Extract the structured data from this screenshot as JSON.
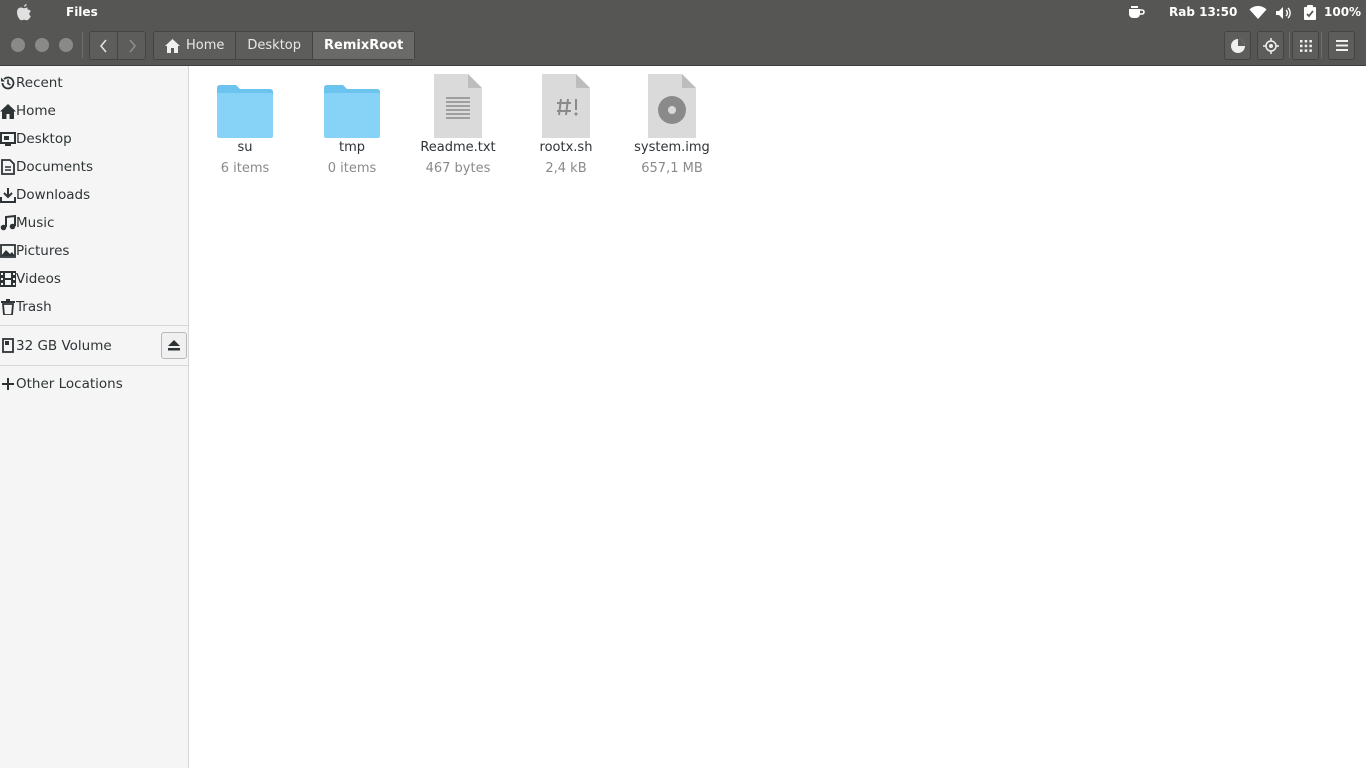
{
  "topbar": {
    "app_name": "Files",
    "clock": "Rab 13:50",
    "battery": "100%",
    "icons": [
      "apple-logo",
      "coffee-icon",
      "wifi-icon",
      "volume-icon",
      "clipboard-check-icon"
    ]
  },
  "headerbar": {
    "breadcrumbs": [
      "Home",
      "Desktop",
      "RemixRoot"
    ],
    "buttons": [
      "pie-chart-icon",
      "location-target-icon",
      "grid-view-icon",
      "menu-icon"
    ]
  },
  "sidebar": {
    "places": [
      {
        "label": "Recent",
        "icon": "recent-icon"
      },
      {
        "label": "Home",
        "icon": "home-icon"
      },
      {
        "label": "Desktop",
        "icon": "desktop-icon"
      },
      {
        "label": "Documents",
        "icon": "documents-icon"
      },
      {
        "label": "Downloads",
        "icon": "downloads-icon"
      },
      {
        "label": "Music",
        "icon": "music-icon"
      },
      {
        "label": "Pictures",
        "icon": "pictures-icon"
      },
      {
        "label": "Videos",
        "icon": "videos-icon"
      },
      {
        "label": "Trash",
        "icon": "trash-icon"
      }
    ],
    "devices": [
      {
        "label": "32 GB Volume",
        "icon": "drive-icon"
      }
    ],
    "other": {
      "label": "Other Locations",
      "icon": "plus-icon"
    }
  },
  "files": [
    {
      "name": "su",
      "meta": "6 items",
      "type": "folder"
    },
    {
      "name": "tmp",
      "meta": "0 items",
      "type": "folder"
    },
    {
      "name": "Readme.txt",
      "meta": "467 bytes",
      "type": "text"
    },
    {
      "name": "rootx.sh",
      "meta": "2,4 kB",
      "type": "script"
    },
    {
      "name": "system.img",
      "meta": "657,1 MB",
      "type": "disk-image"
    }
  ],
  "colors": {
    "panel": "#565654",
    "sidebar": "#f5f5f5",
    "folder": "#7ed0f5",
    "file": "#d9d9d9"
  }
}
